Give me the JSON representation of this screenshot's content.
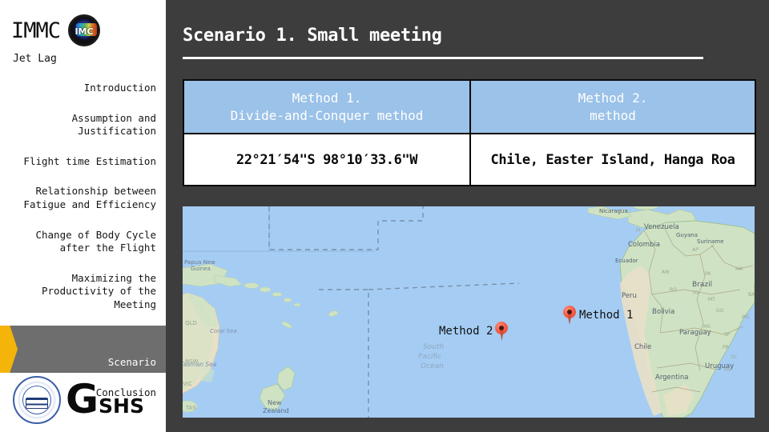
{
  "sidebar": {
    "brand": "IMMC",
    "brand_logo_icon": "immc-badge-icon",
    "subtitle": "Jet Lag",
    "nav_items": [
      {
        "label": "Introduction",
        "active": false
      },
      {
        "label": "Assumption and\nJustification",
        "active": false
      },
      {
        "label": "Flight time Estimation",
        "active": false
      },
      {
        "label": "Relationship between\nFatigue and Efficiency",
        "active": false
      },
      {
        "label": "Change of Body Cycle\nafter the Flight",
        "active": false
      },
      {
        "label": "Maximizing the\nProductivity of the\nMeeting",
        "active": false
      },
      {
        "label": "Scenario",
        "active": true
      },
      {
        "label": "Conclusion",
        "active": false
      }
    ],
    "footer_logo": {
      "emblem_icon": "gshs-school-emblem-icon",
      "g": "G",
      "shs": "SHS"
    },
    "active_color": "#6e6e6e",
    "arrow_color": "#f5b40a"
  },
  "main": {
    "title": "Scenario 1. Small meeting",
    "table": {
      "headers": [
        "Method 1.\nDivide-and-Conquer method",
        "Method 2.\nmethod"
      ],
      "values": [
        "22°21′54\"S 98°10′33.6\"W",
        "Chile, Easter Island, Hanga Roa"
      ],
      "header_bg": "#9bc2e8"
    },
    "map": {
      "ocean_color": "#a5cdf4",
      "land_color": "#cfe3c4",
      "desert_color": "#e8e0c8",
      "labels": [
        "Papua New Guinea",
        "Coral Sea",
        "QLD",
        "NSW",
        "VIC",
        "TAS",
        "Tasman Sea",
        "New Zealand",
        "South Pacific Ocean",
        "Nicaragua",
        "Venezuela",
        "Guyana",
        "Suriname",
        "Colombia",
        "Ecuador",
        "Peru",
        "Brazil",
        "Bolivia",
        "Paraguay",
        "Chile",
        "Uruguay",
        "Argentina",
        "AM",
        "PA",
        "MA",
        "TO",
        "MT",
        "GO",
        "MS",
        "SP",
        "PR",
        "SC",
        "RS",
        "BA",
        "MG",
        "RO",
        "AC",
        "PI",
        "AP"
      ],
      "markers": [
        {
          "label": "Method 1",
          "icon": "map-pin-icon"
        },
        {
          "label": "Method 2",
          "icon": "map-pin-icon"
        }
      ]
    }
  }
}
